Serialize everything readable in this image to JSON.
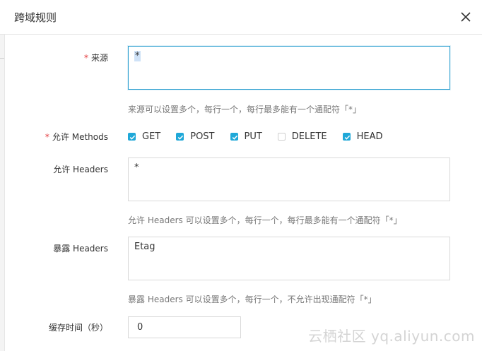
{
  "dialog": {
    "title": "跨域规则",
    "close_icon": "close-icon"
  },
  "origin": {
    "required_mark": "*",
    "label": "来源",
    "value": "*",
    "hint": "来源可以设置多个，每行一个，每行最多能有一个通配符「*」"
  },
  "methods": {
    "required_mark": "*",
    "label": "允许 Methods",
    "items": [
      {
        "label": "GET",
        "checked": true
      },
      {
        "label": "POST",
        "checked": true
      },
      {
        "label": "PUT",
        "checked": true
      },
      {
        "label": "DELETE",
        "checked": false
      },
      {
        "label": "HEAD",
        "checked": true
      }
    ]
  },
  "allowed_headers": {
    "label": "允许 Headers",
    "value": "*",
    "hint": "允许 Headers 可以设置多个，每行一个，每行最多能有一个通配符「*」"
  },
  "expose_headers": {
    "label": "暴露 Headers",
    "value": "Etag",
    "hint": "暴露 Headers 可以设置多个，每行一个，不允许出现通配符「*」"
  },
  "cache_time": {
    "label": "缓存时间（秒）",
    "value": "0"
  },
  "watermark": "云栖社区 yq.aliyun.com",
  "colors": {
    "accent": "#1fa8d8",
    "required": "#e4393c",
    "focus_border": "#2d9fd0"
  }
}
